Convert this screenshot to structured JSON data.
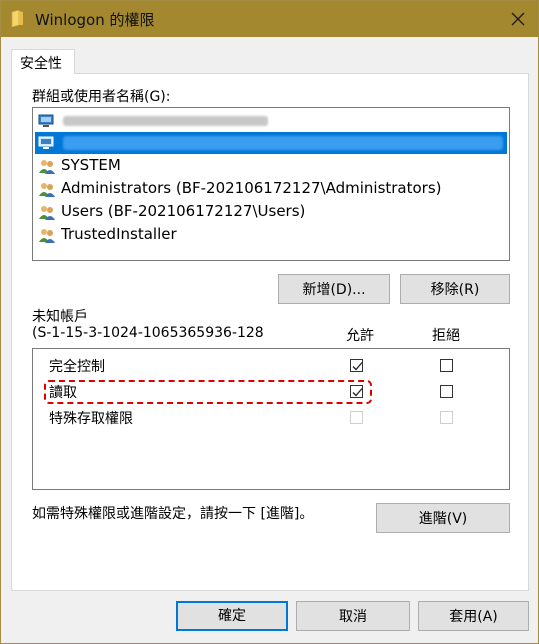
{
  "window": {
    "title": "Winlogon 的權限"
  },
  "tabs": [
    {
      "label": "安全性"
    }
  ],
  "groups": {
    "label": "群組或使用者名稱(G):",
    "items": [
      {
        "label": "SYSTEM",
        "icon": "users-icon"
      },
      {
        "label": "Administrators (BF-202106172127\\Administrators)",
        "icon": "users-icon"
      },
      {
        "label": "Users (BF-202106172127\\Users)",
        "icon": "users-icon"
      },
      {
        "label": "TrustedInstaller",
        "icon": "users-icon"
      }
    ],
    "redacted_items": [
      {
        "icon": "computer-users-icon",
        "selected": false
      },
      {
        "icon": "computer-users-icon",
        "selected": true
      }
    ]
  },
  "buttons": {
    "add": "新增(D)...",
    "remove": "移除(R)",
    "advanced": "進階(V)",
    "ok": "確定",
    "cancel": "取消",
    "apply": "套用(A)"
  },
  "permissions": {
    "principal_name": "未知帳戶",
    "principal_sid": "(S-1-15-3-1024-1065365936-128",
    "allow_header": "允許",
    "deny_header": "拒絕",
    "rows": [
      {
        "name": "完全控制",
        "allow": true,
        "deny": false,
        "disabled": false
      },
      {
        "name": "讀取",
        "allow": true,
        "deny": false,
        "disabled": false
      },
      {
        "name": "特殊存取權限",
        "allow": false,
        "deny": false,
        "disabled": true
      }
    ]
  },
  "advanced_hint": "如需特殊權限或進階設定，請按一下 [進階]。",
  "colors": {
    "titlebar": "#a3882f",
    "selection": "#0078d7",
    "highlight_border": "#dd0000"
  }
}
